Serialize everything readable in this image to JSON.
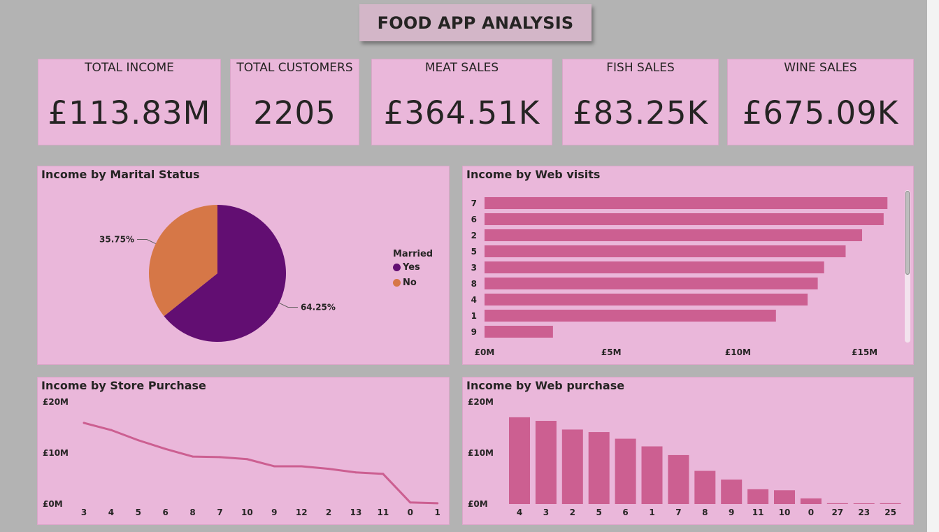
{
  "title": "FOOD APP ANALYSIS",
  "colors": {
    "bar": "#cc5f91",
    "married_yes": "#620e72",
    "married_no": "#d67747",
    "panel": "#eab7da"
  },
  "kpis": [
    {
      "label": "TOTAL INCOME",
      "value": "£113.83M"
    },
    {
      "label": "TOTAL CUSTOMERS",
      "value": "2205"
    },
    {
      "label": "MEAT SALES",
      "value": "£364.51K"
    },
    {
      "label": "FISH SALES",
      "value": "£83.25K"
    },
    {
      "label": "WINE SALES",
      "value": "£675.09K"
    }
  ],
  "pie_panel": {
    "title": "Income by Marital Status",
    "legend_title": "Married",
    "legend_yes": "Yes",
    "legend_no": "No"
  },
  "webvisits_panel": {
    "title": "Income by Web visits"
  },
  "store_panel": {
    "title": "Income by Store Purchase"
  },
  "webpurchase_panel": {
    "title": "Income by Web purchase"
  },
  "chart_data": [
    {
      "type": "pie",
      "title": "Income by Marital Status",
      "legend_title": "Married",
      "labels": [
        "Yes",
        "No"
      ],
      "values": [
        64.25,
        35.75
      ],
      "data_labels": [
        "64.25%",
        "35.75%"
      ]
    },
    {
      "type": "bar",
      "orientation": "horizontal",
      "title": "Income by Web visits",
      "categories": [
        "7",
        "6",
        "2",
        "5",
        "3",
        "8",
        "4",
        "1",
        "9"
      ],
      "values": [
        15.9,
        15.75,
        14.9,
        14.25,
        13.4,
        13.15,
        12.75,
        11.5,
        2.7
      ],
      "xlim": [
        0,
        16.5
      ],
      "ticks": [
        0,
        5,
        10,
        15
      ],
      "tick_labels": [
        "£0M",
        "£5M",
        "£10M",
        "£15M"
      ]
    },
    {
      "type": "line",
      "title": "Income by Store Purchase",
      "categories": [
        "3",
        "4",
        "5",
        "6",
        "8",
        "7",
        "10",
        "9",
        "12",
        "2",
        "13",
        "11",
        "0",
        "1"
      ],
      "values": [
        15.9,
        14.5,
        12.5,
        10.8,
        9.3,
        9.2,
        8.8,
        7.4,
        7.4,
        6.9,
        6.2,
        5.9,
        0.3,
        0.15
      ],
      "ylim": [
        0,
        20
      ],
      "ticks": [
        0,
        10,
        20
      ],
      "tick_labels": [
        "£0M",
        "£10M",
        "£20M"
      ]
    },
    {
      "type": "bar",
      "title": "Income by Web purchase",
      "categories": [
        "4",
        "3",
        "2",
        "5",
        "6",
        "1",
        "7",
        "8",
        "9",
        "11",
        "10",
        "0",
        "27",
        "23",
        "25"
      ],
      "values": [
        17.0,
        16.3,
        14.6,
        14.1,
        12.8,
        11.3,
        9.6,
        6.5,
        4.8,
        2.9,
        2.7,
        1.1,
        0.15,
        0.12,
        0.15
      ],
      "ylim": [
        0,
        20
      ],
      "ticks": [
        0,
        10,
        20
      ],
      "tick_labels": [
        "£0M",
        "£10M",
        "£20M"
      ]
    }
  ]
}
